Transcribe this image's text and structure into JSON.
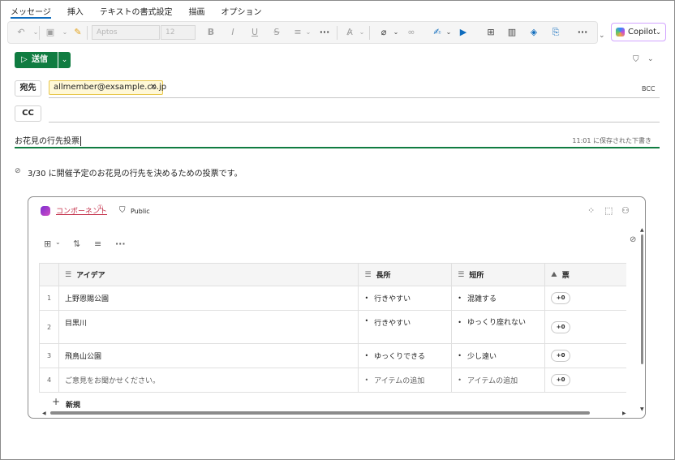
{
  "ribbon": {
    "tabs": [
      "メッセージ",
      "挿入",
      "テキストの書式設定",
      "描画",
      "オプション"
    ],
    "active_tab": "メッセージ",
    "font_name": "Aptos",
    "font_size": "12",
    "copilot_label": "Copilot",
    "icons": [
      "undo-icon",
      "clipboard-icon",
      "format-painter-icon",
      "bold-icon",
      "italic-icon",
      "underline-icon",
      "strikethrough-icon",
      "line-spacing-icon",
      "more-icon",
      "styles-icon",
      "attach-icon",
      "link-icon",
      "signature-icon",
      "meeting-icon",
      "apps-icon",
      "poll-icon",
      "loop-icon",
      "save-icon",
      "more-icon"
    ]
  },
  "compose": {
    "send_label": "送信",
    "to_label": "宛先",
    "cc_label": "CC",
    "bcc_label": "BCC",
    "recipient": "allmember@exsample.co.jp",
    "subject": "お花見の行先投票",
    "saved_status": "11:01 に保存された下書き",
    "body_text": "3/30 に開催予定のお花見の行先を決めるための投票です。"
  },
  "loop": {
    "title": "コンポーネント",
    "title_suffix": "①",
    "visibility": "Public",
    "columns": [
      "アイデア",
      "長所",
      "短所",
      "票"
    ],
    "rows": [
      {
        "num": "1",
        "idea": "上野恩賜公園",
        "pro": "行きやすい",
        "con": "混雑する",
        "vote": "+0"
      },
      {
        "num": "2",
        "idea": "目黒川",
        "pro": "行きやすい",
        "con": "ゆっくり座れない",
        "vote": "+0"
      },
      {
        "num": "3",
        "idea": "飛鳥山公園",
        "pro": "ゆっくりできる",
        "con": "少し遠い",
        "vote": "+0"
      },
      {
        "num": "4",
        "idea": "ご意見をお聞かせください。",
        "pro": "アイテムの追加",
        "con": "アイテムの追加",
        "vote": "+0"
      }
    ],
    "new_label": "新規"
  }
}
